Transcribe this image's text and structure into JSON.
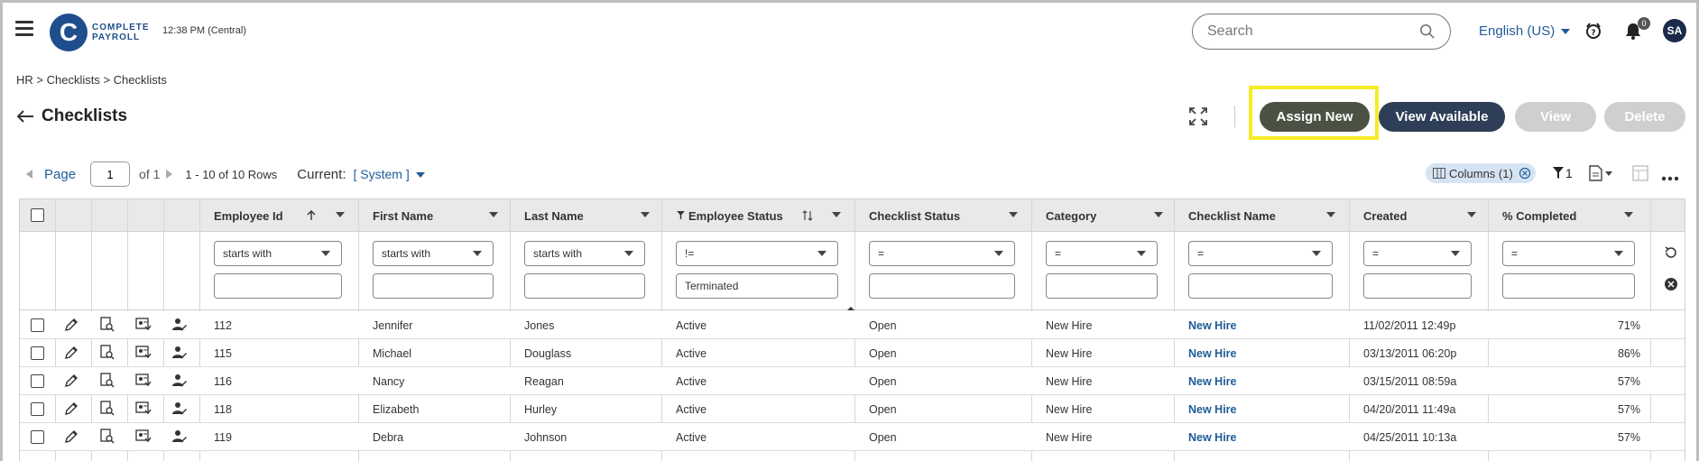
{
  "header": {
    "logo_letter": "C",
    "logo_line1": "COMPLETE",
    "logo_line2": "PAYROLL",
    "time": "12:38 PM (Central)",
    "search_placeholder": "Search",
    "language": "English (US)",
    "notification_count": "0",
    "avatar_initials": "SA"
  },
  "breadcrumb": "HR  >  Checklists  >  Checklists",
  "page_title": "Checklists",
  "actions": {
    "assign_new": "Assign New",
    "view_available": "View Available",
    "view": "View",
    "delete": "Delete"
  },
  "pager": {
    "page_label": "Page",
    "page_value": "1",
    "of_label": "of 1",
    "rows_info": "1 - 10 of 10 Rows",
    "current_label": "Current:",
    "current_value": "[ System ]"
  },
  "toolbar": {
    "columns_chip": "Columns (1)",
    "filter_count": "1"
  },
  "grid": {
    "columns": [
      "Employee Id",
      "First Name",
      "Last Name",
      "Employee Status",
      "Checklist Status",
      "Category",
      "Checklist Name",
      "Created",
      "% Completed"
    ],
    "filters": [
      {
        "op": "starts with",
        "value": ""
      },
      {
        "op": "starts with",
        "value": ""
      },
      {
        "op": "starts with",
        "value": ""
      },
      {
        "op": "!=",
        "value": "Terminated"
      },
      {
        "op": "=",
        "value": ""
      },
      {
        "op": "=",
        "value": ""
      },
      {
        "op": "=",
        "value": ""
      },
      {
        "op": "=",
        "value": ""
      },
      {
        "op": "=",
        "value": ""
      }
    ],
    "rows": [
      {
        "id": "112",
        "first": "Jennifer",
        "last": "Jones",
        "emp_status": "Active",
        "cl_status": "Open",
        "category": "New Hire",
        "name": "New Hire",
        "created": "11/02/2011 12:49p",
        "pct": "71%"
      },
      {
        "id": "115",
        "first": "Michael",
        "last": "Douglass",
        "emp_status": "Active",
        "cl_status": "Open",
        "category": "New Hire",
        "name": "New Hire",
        "created": "03/13/2011 06:20p",
        "pct": "86%"
      },
      {
        "id": "116",
        "first": "Nancy",
        "last": "Reagan",
        "emp_status": "Active",
        "cl_status": "Open",
        "category": "New Hire",
        "name": "New Hire",
        "created": "03/15/2011 08:59a",
        "pct": "57%"
      },
      {
        "id": "118",
        "first": "Elizabeth",
        "last": "Hurley",
        "emp_status": "Active",
        "cl_status": "Open",
        "category": "New Hire",
        "name": "New Hire",
        "created": "04/20/2011 11:49a",
        "pct": "57%"
      },
      {
        "id": "119",
        "first": "Debra",
        "last": "Johnson",
        "emp_status": "Active",
        "cl_status": "Open",
        "category": "New Hire",
        "name": "New Hire",
        "created": "04/25/2011 10:13a",
        "pct": "57%"
      }
    ]
  }
}
